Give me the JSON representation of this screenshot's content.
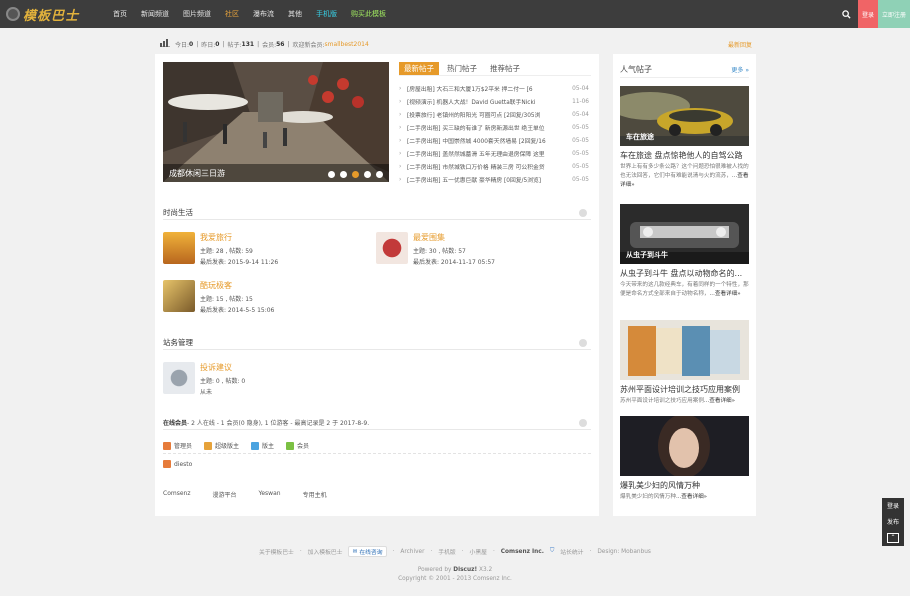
{
  "header": {
    "logo_text": "模板巴士",
    "nav": [
      {
        "label": "首页",
        "style": ""
      },
      {
        "label": "新闻频道",
        "style": ""
      },
      {
        "label": "图片频道",
        "style": ""
      },
      {
        "label": "社区",
        "style": "active"
      },
      {
        "label": "瀑布流",
        "style": ""
      },
      {
        "label": "其他",
        "style": ""
      },
      {
        "label": "手机版",
        "style": "cyan"
      },
      {
        "label": "购买此模板",
        "style": "green"
      }
    ],
    "login_label": "登录",
    "register_label": "立即注册",
    "search_icon": "search-icon"
  },
  "stats": {
    "today_label": "今日:",
    "today": "0",
    "yesterday_label": "昨日:",
    "yesterday": "0",
    "posts_label": "帖子:",
    "posts": "131",
    "members_label": "会员:",
    "members": "56",
    "welcome_label": "欢迎新会员:",
    "new_member": "smallbest2014",
    "latest_reply": "最新回复"
  },
  "slideshow": {
    "caption": "成都休闲三日游",
    "dots": 5,
    "active_dot": 2
  },
  "tabs": [
    "最新帖子",
    "热门帖子",
    "推荐帖子"
  ],
  "threads": [
    {
      "title": "[房屋出租] 大石三和大厦1万$2平米 押二付一 [6",
      "date": "05-04"
    },
    {
      "title": "[视频演示] 机器人大战！David Guetta联手Nicki",
      "date": "11-06"
    },
    {
      "title": "[投票旅行] 老镇州的阳阳光 可圈可点 [2回复/305浏",
      "date": "05-04"
    },
    {
      "title": "[二手房出租] 买三缺的有谁了 新房新源出世 绝王单位",
      "date": "05-05"
    },
    {
      "title": "[二手房出租] 中国崇然城 4000套天然墙易 [2回复/16",
      "date": "05-05"
    },
    {
      "title": "[二手房出租] 盖然然城墓滑 五年无理由退房保障 这里",
      "date": "05-05"
    },
    {
      "title": "[二手房出租] 市然城铁口万价格 精装三房 可公积金贷",
      "date": "05-05"
    },
    {
      "title": "[二手房出租] 五一优惠巨献 豪华精房 [0回复/5浏览]",
      "date": "05-05"
    }
  ],
  "sections": {
    "life_title": "时尚生活",
    "admin_title": "站务管理"
  },
  "forums": [
    {
      "name": "我爱旅行",
      "topics": "主题: 28 , 帖数: 59",
      "last": "最后发表: 2015-9-14 11:26"
    },
    {
      "name": "最爱围集",
      "topics": "主题: 30 , 帖数: 57",
      "last": "最后发表: 2014-11-17 05:57"
    },
    {
      "name": "酷玩极客",
      "topics": "主题: 15 , 帖数: 15",
      "last": "最后发表: 2014-5-5 15:06"
    },
    {
      "name": "投诉建议",
      "topics": "主题: 0 , 帖数: 0",
      "last": "从未"
    }
  ],
  "online": {
    "label": "在线会员",
    "text": " - 2 人在线 - 1 会员(0 隐身), 1 位游客 - 最高记录是 2 于 2017-8-9.",
    "legend": [
      {
        "label": "管理员",
        "color": "#e67b3a"
      },
      {
        "label": "超级版主",
        "color": "#e6a23a"
      },
      {
        "label": "版主",
        "color": "#4aa3e0"
      },
      {
        "label": "会员",
        "color": "#7bc043"
      }
    ],
    "user": "diesto"
  },
  "friend_links": [
    "Comsenz",
    "漫游平台",
    "Yeswan",
    "专用主机"
  ],
  "sidebar": {
    "title": "人气帖子",
    "more": "更多 »",
    "cards": [
      {
        "overlay": "车在旅途",
        "title": "车在旅途 盘点惊艳他人的自驾公路",
        "desc": "世界上有有多少条公路？这个问题恐怕很难被人找的也无法回答，它们中有难能说清与火的流苏，",
        "more": "...查看详细»"
      },
      {
        "overlay": "从虫子到斗牛",
        "title": "从虫子到斗牛 盘点以动物命名的...",
        "desc": "今天带来的这几款经典车，有着同样的一个特性，那便是命名方式全部来自于动物名称，",
        "more": "...查看详细»"
      },
      {
        "overlay": "",
        "title": "苏州平面设计培训之技巧应用案例",
        "desc": "苏州平面设计培训之技巧应用案例",
        "more": "...查看详细»"
      },
      {
        "overlay": "",
        "title": "爆乳美少妇的风情万种",
        "desc": "爆乳美少妇的风情万种",
        "more": "...查看详细»"
      }
    ]
  },
  "footer": {
    "links": [
      "关于模板巴士",
      "加入模板巴士",
      "在线客服",
      "Archiver",
      "手机版",
      "小黑屋"
    ],
    "online_badge": "在线咨询",
    "comsenz": "Comsenz Inc.",
    "stats_label": "站长统计",
    "design": "Design: Mobanbus",
    "powered": "Powered by",
    "discuz": "Discuz!",
    "version": "X3.2",
    "copyright": "Copyright © 2001 - 2013 Comsenz Inc."
  },
  "fixbar": {
    "login": "登录",
    "post": "发布",
    "top_icon": "back-to-top-icon"
  },
  "colors": {
    "accent": "#e69a2a",
    "topbar": "#3d3d3d",
    "login": "#f06466",
    "register": "#8fd1b6"
  }
}
